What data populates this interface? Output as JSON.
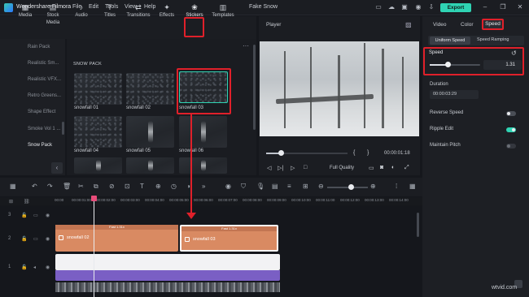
{
  "titlebar": {
    "app_name": "Wondershare Filmora",
    "menus": [
      "File",
      "Edit",
      "Tools",
      "View",
      "Help"
    ],
    "doc_title": "Fake Snow",
    "export": "Export"
  },
  "media_tabs": [
    {
      "label": "Media",
      "icon": "media-icon"
    },
    {
      "label": "Stock Media",
      "icon": "stock-media-icon"
    },
    {
      "label": "Audio",
      "icon": "audio-icon"
    },
    {
      "label": "Titles",
      "icon": "titles-icon"
    },
    {
      "label": "Transitions",
      "icon": "transitions-icon"
    },
    {
      "label": "Effects",
      "icon": "effects-icon"
    },
    {
      "label": "Stickers",
      "icon": "stickers-icon"
    },
    {
      "label": "Templates",
      "icon": "templates-icon"
    }
  ],
  "sidebar": {
    "items": [
      "Rain Pack",
      "Realistic Sm...",
      "Realistic VFX...",
      "Retro Greens...",
      "Shape Effect",
      "Smoke Vol 1 ...",
      "Snow Pack"
    ],
    "active": "Snow Pack"
  },
  "gallery": {
    "pack_title": "SNOW PACK",
    "items": [
      "snowfall 01",
      "snowfall 02",
      "snowfall 03",
      "snowfall 04",
      "snowfall 05",
      "snowfall 06"
    ]
  },
  "player": {
    "title": "Player",
    "time": "00:00:01:18",
    "quality": "Full Quality",
    "progress": 0.18
  },
  "right_panel": {
    "tabs": [
      "Video",
      "Color",
      "Speed"
    ],
    "sub_tabs": [
      "Uniform Speed",
      "Speed Ramping"
    ],
    "speed_label": "Speed",
    "speed_value": "1.31",
    "speed_fraction": 0.35,
    "duration_label": "Duration",
    "duration_value": "00:00:03:29",
    "options": [
      {
        "label": "Reverse Speed",
        "on": false
      },
      {
        "label": "Ripple Edit",
        "on": true
      },
      {
        "label": "Maintain Pitch",
        "on": false
      }
    ]
  },
  "timeline": {
    "ruler": [
      "00:00",
      "00:00:01:00",
      "00:00:02:00",
      "00:00:03:00",
      "00:00:04:00",
      "00:00:05:00",
      "00:00:06:00",
      "00:00:07:00",
      "00:00:08:00",
      "00:00:09:00",
      "00:00:10:00",
      "00:00:11:00",
      "00:00:12:00",
      "00:00:13:00",
      "00:00:14:00"
    ],
    "track_numbers": [
      "3",
      "2",
      "1"
    ],
    "clips": [
      {
        "name": "snowfall 02",
        "head": "Fast 1.31x"
      },
      {
        "name": "snowfall 03",
        "head": "Fast 1.31x"
      }
    ]
  },
  "watermark": "wtvid.com",
  "colors": {
    "accent": "#2fd3b3",
    "highlight": "#e0202a",
    "clip": "#d98a62",
    "purple": "#7a5fc4"
  }
}
